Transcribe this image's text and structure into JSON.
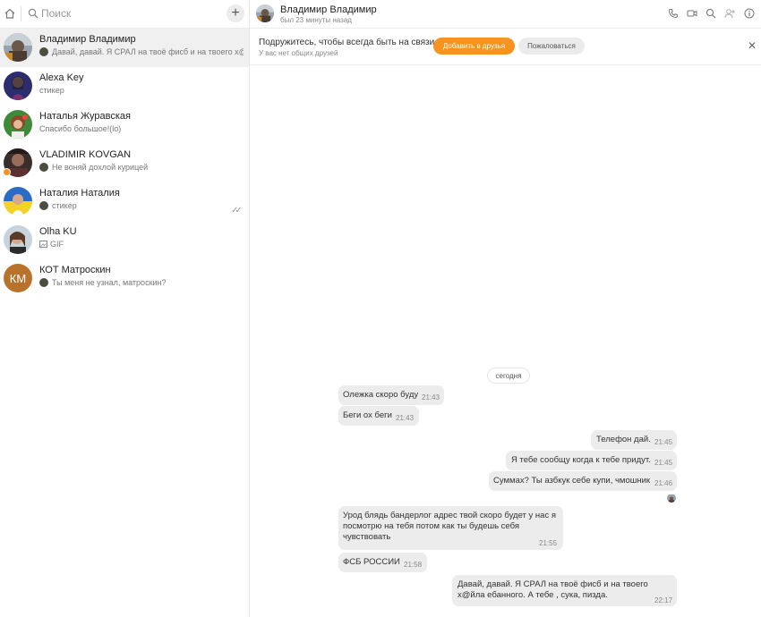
{
  "sidebar": {
    "search_placeholder": "Поиск",
    "new_chat": "+",
    "chats": [
      {
        "name": "Владимир Владимир",
        "preview": "Давай, давай. Я СРАЛ на твоё фисб и на твоего х@йл...",
        "active": true
      },
      {
        "name": "Alexa Key",
        "preview": "стикер"
      },
      {
        "name": "Наталья Журавская",
        "preview": "Спасибо большое!(lo)"
      },
      {
        "name": "VLADIMIR KOVGAN",
        "preview": "Не воняй дохлой курицей"
      },
      {
        "name": "Наталия Наталия",
        "preview": "стикер",
        "read": "✓✓"
      },
      {
        "name": "Olha KU",
        "preview": "GIF"
      },
      {
        "name": "КОТ Матроскин",
        "initials": "КМ",
        "preview": "Ты меня не узнал, матроскин?"
      }
    ]
  },
  "header": {
    "name": "Владимир Владимир",
    "status": "был 23 минуты назад",
    "icons": [
      "phone-icon",
      "video-icon",
      "search-icon",
      "add-user-icon",
      "info-icon"
    ]
  },
  "banner": {
    "title": "Подружитесь, чтобы всегда быть на связи",
    "subtitle": "У вас нет общих друзей",
    "add_button": "Добавить в друзья",
    "report_button": "Пожаловаться",
    "close": "✕"
  },
  "messages": {
    "date": "сегодня",
    "items": [
      {
        "text": "Олежка скоро буду",
        "time": "21:43",
        "side": "in"
      },
      {
        "text": "Беги ох беги",
        "time": "21:43",
        "side": "in"
      },
      {
        "text": "Телефон дай.",
        "time": "21:45",
        "side": "out"
      },
      {
        "text": "Я тебе сообщу когда к тебе придут.",
        "time": "21:45",
        "side": "out"
      },
      {
        "text": "Суммах?  Ты азбкук себе купи, чмошник",
        "time": "21:46",
        "side": "out"
      },
      {
        "text": "Урод блядь бандерлог адрес твой скоро будет у нас я\nпосмотрю на тебя потом как ты будешь себя\nчувствовать",
        "time": "21:55",
        "side": "in"
      },
      {
        "text": "ФСБ РОССИИ",
        "time": "21:58",
        "side": "in"
      },
      {
        "text": "Давай, давай. Я СРАЛ на твоё  фисб и на твоего\nх@йла ебанного.  А тебе , сука, пизда.",
        "time": "22:17",
        "side": "out"
      }
    ]
  },
  "colors": {
    "accent": "#f7931e",
    "bubble": "#ececec",
    "active_chat": "#f0f0f0"
  }
}
